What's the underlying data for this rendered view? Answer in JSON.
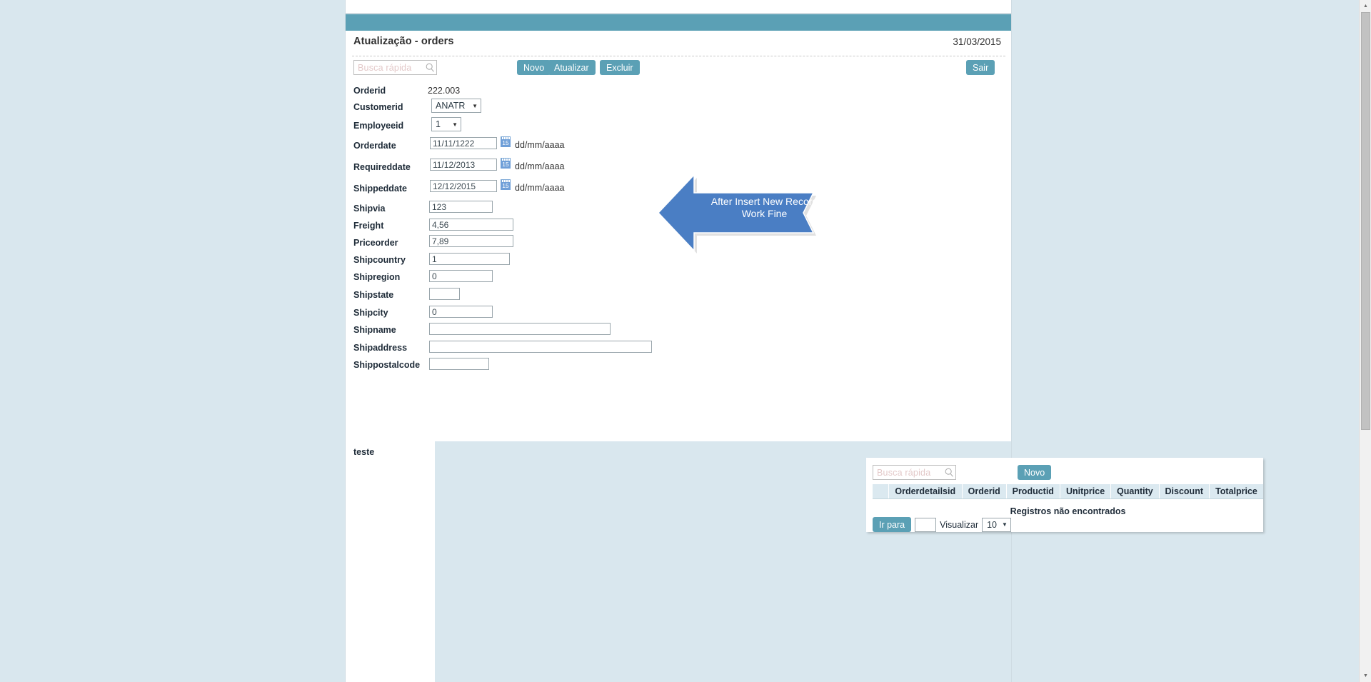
{
  "header": {
    "title": "Atualização - orders",
    "date": "31/03/2015"
  },
  "toolbar": {
    "search_placeholder": "Busca rápida",
    "novo_label": "Novo",
    "atualizar_label": "Atualizar",
    "excluir_label": "Excluir",
    "sair_label": "Sair"
  },
  "form": {
    "fields": [
      {
        "label": "Orderid",
        "type": "static",
        "value": "222.003"
      },
      {
        "label": "Customerid",
        "type": "select",
        "value": "ANATR"
      },
      {
        "label": "Employeeid",
        "type": "select",
        "value": "1"
      },
      {
        "label": "Orderdate",
        "type": "date",
        "value": "11/11/1222",
        "hint": "dd/mm/aaaa"
      },
      {
        "label": "Requireddate",
        "type": "date",
        "value": "11/12/2013",
        "hint": "dd/mm/aaaa"
      },
      {
        "label": "Shippeddate",
        "type": "date",
        "value": "12/12/2015",
        "hint": "dd/mm/aaaa"
      },
      {
        "label": "Shipvia",
        "type": "text",
        "value": "123"
      },
      {
        "label": "Freight",
        "type": "text",
        "value": "4,56"
      },
      {
        "label": "Priceorder",
        "type": "text",
        "value": "7,89"
      },
      {
        "label": "Shipcountry",
        "type": "text",
        "value": "1"
      },
      {
        "label": "Shipregion",
        "type": "text",
        "value": "0"
      },
      {
        "label": "Shipstate",
        "type": "text",
        "value": ""
      },
      {
        "label": "Shipcity",
        "type": "text",
        "value": "0"
      },
      {
        "label": "Shipname",
        "type": "text",
        "value": ""
      },
      {
        "label": "Shipaddress",
        "type": "text",
        "value": ""
      },
      {
        "label": "Shippostalcode",
        "type": "text",
        "value": ""
      }
    ],
    "teste_label": "teste",
    "calendar_day": "15"
  },
  "grid": {
    "search_placeholder": "Busca rápida",
    "novo_label": "Novo",
    "columns": [
      "Orderdetailsid",
      "Orderid",
      "Productid",
      "Unitprice",
      "Quantity",
      "Discount",
      "Totalprice"
    ],
    "empty_message": "Registros não encontrados",
    "goto_label": "Ir para",
    "page_value": "",
    "view_label": "Visualizar",
    "view_value": "10"
  },
  "callout": {
    "text": "After Insert New Record\nWork Fine",
    "color": "#4a7ec4"
  },
  "theme": {
    "accent": "#5ba0b5",
    "page_background": "#d9e7ee",
    "panel_background": "#d9e7ee",
    "header_band": "#5ba0b5"
  }
}
